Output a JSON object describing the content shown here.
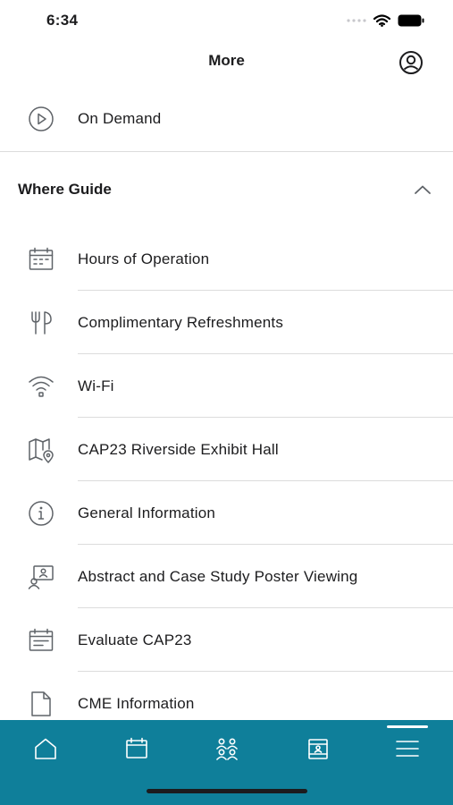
{
  "status_bar": {
    "time": "6:34"
  },
  "nav": {
    "title": "More",
    "profile_icon": "profile-icon"
  },
  "top_items": [
    {
      "label": "On Demand",
      "icon": "play-circle-icon"
    }
  ],
  "section": {
    "title": "Where Guide",
    "expanded": true,
    "items": [
      {
        "label": "Hours of Operation",
        "icon": "calendar-icon"
      },
      {
        "label": "Complimentary Refreshments",
        "icon": "fork-knife-icon"
      },
      {
        "label": "Wi-Fi",
        "icon": "wifi-icon"
      },
      {
        "label": "CAP23 Riverside Exhibit Hall",
        "icon": "map-pin-icon"
      },
      {
        "label": "General Information",
        "icon": "info-icon"
      },
      {
        "label": "Abstract and Case Study Poster Viewing",
        "icon": "poster-viewing-icon"
      },
      {
        "label": "Evaluate CAP23",
        "icon": "evaluate-calendar-icon"
      },
      {
        "label": "CME Information",
        "icon": "document-icon"
      }
    ]
  },
  "tab_bar": {
    "color": "#0f7f9a",
    "tabs": [
      {
        "icon": "home-icon"
      },
      {
        "icon": "calendar-icon"
      },
      {
        "icon": "people-icon"
      },
      {
        "icon": "badge-icon"
      },
      {
        "icon": "menu-icon",
        "selected": true
      }
    ]
  }
}
